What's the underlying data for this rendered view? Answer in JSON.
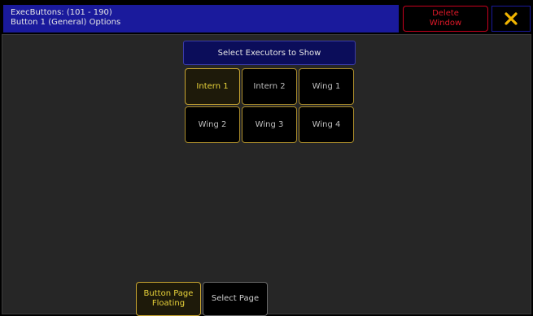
{
  "titlebar": {
    "line1": "ExecButtons: (101 - 190)",
    "line2": "Button  1 (General)   Options",
    "delete_line1": "Delete",
    "delete_line2": "Window",
    "close_icon": "close-x-icon",
    "close_color": "#f0b400"
  },
  "main": {
    "header": "Select Executors to Show",
    "executors": [
      {
        "label": "Intern 1",
        "active": true
      },
      {
        "label": "Intern 2",
        "active": false
      },
      {
        "label": "Wing 1",
        "active": false
      },
      {
        "label": "Wing 2",
        "active": false
      },
      {
        "label": "Wing 3",
        "active": false
      },
      {
        "label": "Wing 4",
        "active": false
      }
    ]
  },
  "footer": {
    "floating_line1": "Button Page",
    "floating_line2": "Floating",
    "select_page": "Select Page"
  },
  "colors": {
    "title_bg": "#1a1a9c",
    "accent_gold": "#c9a531",
    "active_text": "#e8d23a",
    "delete_red": "#e01828"
  }
}
